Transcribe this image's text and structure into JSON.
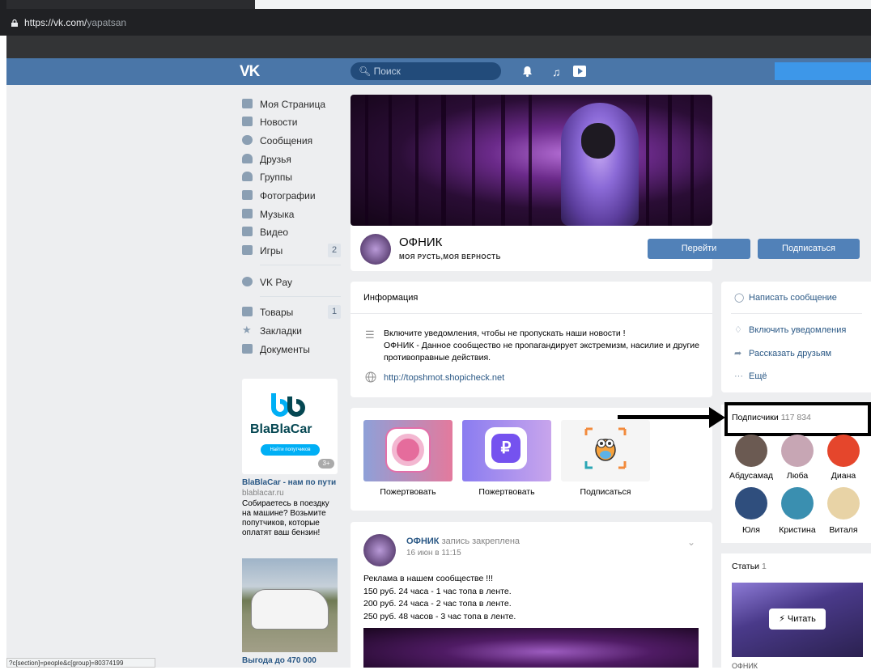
{
  "browser": {
    "url_host": "https://vk.com/",
    "url_path": "yapatsan",
    "status_url": "?c[section]=people&c[group]=80374199"
  },
  "header": {
    "logo": "VK",
    "search_placeholder": "Поиск"
  },
  "nav": [
    {
      "label": "Моя Страница",
      "icon": "home-icon"
    },
    {
      "label": "Новости",
      "icon": "news-icon"
    },
    {
      "label": "Сообщения",
      "icon": "messages-icon"
    },
    {
      "label": "Друзья",
      "icon": "friends-icon"
    },
    {
      "label": "Группы",
      "icon": "groups-icon"
    },
    {
      "label": "Фотографии",
      "icon": "camera-icon"
    },
    {
      "label": "Музыка",
      "icon": "music-icon"
    },
    {
      "label": "Видео",
      "icon": "video-icon"
    },
    {
      "label": "Игры",
      "icon": "games-icon",
      "count": "2"
    },
    {
      "label": "VK Pay",
      "icon": "vkpay-icon"
    },
    {
      "label": "Товары",
      "icon": "bag-icon",
      "count": "1"
    },
    {
      "label": "Закладки",
      "icon": "star-icon"
    },
    {
      "label": "Документы",
      "icon": "document-icon"
    }
  ],
  "ads": [
    {
      "brand": "BlaBlaCar",
      "button": "Найти попутчиков",
      "age": "3+",
      "title": "BlaBlaCar - нам по пути",
      "url": "blablacar.ru",
      "text": "Собираетесь в поездку на машине? Возьмите попутчиков, которые оплатят ваш бензин!"
    },
    {
      "title": "Выгода до 470 000"
    }
  ],
  "group": {
    "name": "ОФНИК",
    "subtitle": "МОЯ РУСТЬ,МОЯ ВЕРНОСТЬ",
    "go_button": "Перейти",
    "subscribe_button": "Подписаться"
  },
  "info": {
    "title": "Информация",
    "line1": "Включите уведомления, чтобы не пропускать наши новости !",
    "line2": "ОФНИК - Данное сообщество не пропагандирует экстремизм, насилие и другие противоправные действия.",
    "link": "http://topshmot.shopicheck.net"
  },
  "apps": [
    {
      "label": "Пожертвовать"
    },
    {
      "label": "Пожертвовать"
    },
    {
      "label": "Подписаться"
    }
  ],
  "post": {
    "author": "ОФНИК",
    "pinned": "запись закреплена",
    "date": "16 июн в 11:15",
    "lines": [
      "Реклама в нашем сообществе !!!",
      "150 руб. 24 часа - 1 час топа в ленте.",
      "200 руб. 24 часа - 2 час топа в ленте.",
      "250 руб. 48 часов - 3 час топа в ленте."
    ]
  },
  "actions": [
    {
      "label": "Написать сообщение",
      "icon": "message-icon"
    },
    {
      "label": "Включить уведомления",
      "icon": "bell-icon"
    },
    {
      "label": "Рассказать друзьям",
      "icon": "share-icon"
    },
    {
      "label": "Ещё",
      "icon": "more-icon"
    }
  ],
  "subscribers": {
    "title": "Подписчики",
    "count": "117 834",
    "people": [
      {
        "name": "Абдусамад",
        "color": "#6b5a52"
      },
      {
        "name": "Люба",
        "color": "#c7a6b4"
      },
      {
        "name": "Диана",
        "color": "#e5462c"
      },
      {
        "name": "Юля",
        "color": "#2f4e7d"
      },
      {
        "name": "Кристина",
        "color": "#3a8fb0"
      },
      {
        "name": "Виталя",
        "color": "#e8d3a6"
      }
    ]
  },
  "articles": {
    "title": "Статьи",
    "count": "1",
    "read_button": "Читать",
    "name": "ОФНИК"
  }
}
